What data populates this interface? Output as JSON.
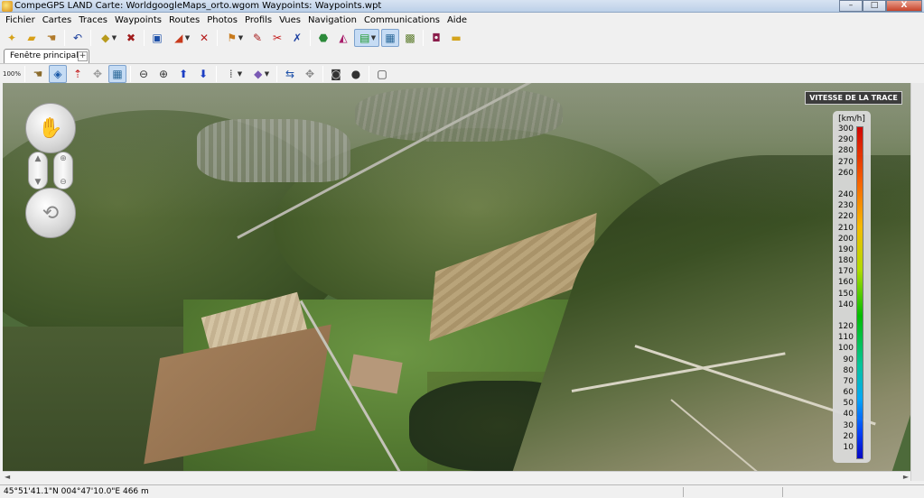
{
  "window": {
    "title": "CompeGPS LAND Carte: WorldgoogleMaps_orto.wgom Waypoints:  Waypoints.wpt",
    "buttons": {
      "minimize": "–",
      "maximize": "□",
      "close": "X"
    }
  },
  "menu": [
    "Fichier",
    "Cartes",
    "Traces",
    "Waypoints",
    "Routes",
    "Photos",
    "Profils",
    "Vues",
    "Navigation",
    "Communications",
    "Aide"
  ],
  "toolbar1": [
    {
      "name": "new-project-icon",
      "glyph": "✦",
      "color": "#d6a21a"
    },
    {
      "name": "open-folder-icon",
      "glyph": "▰",
      "color": "#d8a018"
    },
    {
      "name": "hand-cursor-icon",
      "glyph": "☚",
      "color": "#b07a2a"
    },
    {
      "sep": true
    },
    {
      "name": "undo-icon",
      "glyph": "↶",
      "color": "#1c3f9c"
    },
    {
      "sep": true
    },
    {
      "name": "waypoint-add-icon",
      "glyph": "◆",
      "color": "#b89a1c",
      "dropdown": true
    },
    {
      "name": "waypoint-delete-icon",
      "glyph": "✖",
      "color": "#a01c1c"
    },
    {
      "sep": true
    },
    {
      "name": "fit-window-icon",
      "glyph": "▣",
      "color": "#1c4fa8"
    },
    {
      "name": "track-tool-icon",
      "glyph": "◢",
      "color": "#c83a1c",
      "dropdown": true
    },
    {
      "name": "track-delete-icon",
      "glyph": "✕",
      "color": "#b41c1c"
    },
    {
      "sep": true
    },
    {
      "name": "route-tool-icon",
      "glyph": "⚑",
      "color": "#c87a1c",
      "dropdown": true
    },
    {
      "name": "route-edit-icon",
      "glyph": "✎",
      "color": "#a81c1c"
    },
    {
      "name": "route-cut-icon",
      "glyph": "✂",
      "color": "#c41c1c"
    },
    {
      "name": "route-close-icon",
      "glyph": "✗",
      "color": "#1c3fa0"
    },
    {
      "sep": true
    },
    {
      "name": "waypoint-list-icon",
      "glyph": "⬣",
      "color": "#2c8a3a"
    },
    {
      "name": "profile-chart-icon",
      "glyph": "◭",
      "color": "#a81c6a"
    },
    {
      "name": "color-legend-icon",
      "glyph": "▤",
      "color": "#1c9a2c",
      "dropdown": true,
      "active": true
    },
    {
      "name": "view-3d-icon",
      "glyph": "▦",
      "color": "#2c6a9a",
      "active": true
    },
    {
      "name": "grid-icon",
      "glyph": "▩",
      "color": "#5a7a2a"
    },
    {
      "sep": true
    },
    {
      "name": "book-icon",
      "glyph": "◘",
      "color": "#8a1c4a"
    },
    {
      "name": "note-icon",
      "glyph": "▬",
      "color": "#d4a41c"
    }
  ],
  "tabs": {
    "main": "Fenêtre principale",
    "add": "+"
  },
  "toolbar2": [
    {
      "name": "scale-100-icon",
      "glyph": "⟲",
      "color": "#222",
      "label": "100%"
    },
    {
      "sep": true
    },
    {
      "name": "hand-pan-icon",
      "glyph": "☚",
      "color": "#8a6a2a"
    },
    {
      "name": "map-select-icon",
      "glyph": "◈",
      "color": "#1c5aa8",
      "active": true
    },
    {
      "name": "north-arrow-icon",
      "glyph": "⇡",
      "color": "#c41c1c"
    },
    {
      "name": "move-cross-icon",
      "glyph": "✥",
      "color": "#9a9a9a"
    },
    {
      "name": "map-3d-icon",
      "glyph": "▦",
      "color": "#2c6a9a",
      "active": true
    },
    {
      "sep": true
    },
    {
      "name": "zoom-out-icon",
      "glyph": "⊖",
      "color": "#333"
    },
    {
      "name": "zoom-in-icon",
      "glyph": "⊕",
      "color": "#333"
    },
    {
      "name": "arrow-up-icon",
      "glyph": "⬆",
      "color": "#1c3fc4"
    },
    {
      "name": "arrow-down-icon",
      "glyph": "⬇",
      "color": "#1c3fc4"
    },
    {
      "sep": true
    },
    {
      "name": "layer-tool-icon",
      "glyph": "⁞",
      "color": "#555",
      "dropdown": true
    },
    {
      "name": "layer-color-icon",
      "glyph": "◆",
      "color": "#7a5ab4",
      "dropdown": true
    },
    {
      "sep": true
    },
    {
      "name": "transfer-icon",
      "glyph": "⇆",
      "color": "#1c4fa8"
    },
    {
      "name": "compass-icon",
      "glyph": "✥",
      "color": "#8a8a8a"
    },
    {
      "sep": true
    },
    {
      "name": "camera-icon",
      "glyph": "◙",
      "color": "#333"
    },
    {
      "name": "film-icon",
      "glyph": "●",
      "color": "#333"
    },
    {
      "sep": true
    },
    {
      "name": "window-icon",
      "glyph": "▢",
      "color": "#333"
    }
  ],
  "speed_legend": {
    "title": "VITESSE DE LA TRACE",
    "unit": "[km/h]",
    "ticks": [
      "300",
      "290",
      "280",
      "270",
      "260",
      "240",
      "230",
      "220",
      "210",
      "200",
      "190",
      "180",
      "170",
      "160",
      "150",
      "140",
      "120",
      "110",
      "100",
      "90",
      "80",
      "70",
      "60",
      "50",
      "40",
      "30",
      "20",
      "10"
    ]
  },
  "status": {
    "coords": "45°51'41.1\"N 004°47'10.0\"E  466 m"
  }
}
